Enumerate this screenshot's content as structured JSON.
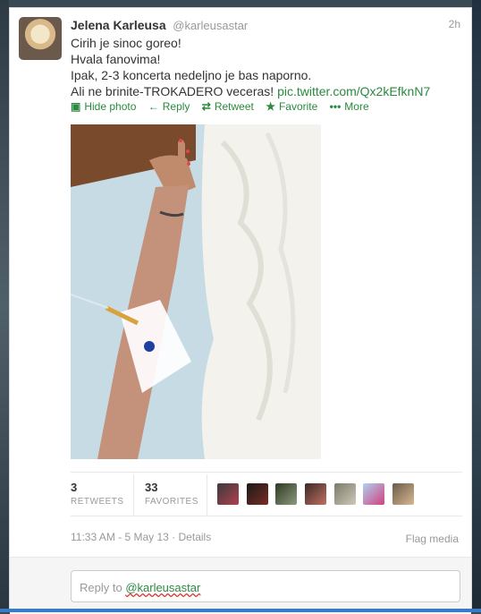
{
  "tweet": {
    "fullname": "Jelena Karleusa",
    "username": "@karleusastar",
    "time": "2h",
    "lines": [
      "Cirih je sinoc goreo!",
      "Hvala fanovima!",
      "Ipak, 2-3 koncerta nedeljno je bas naporno.",
      "Ali ne brinite-TROKADERO veceras! "
    ],
    "link": "pic.twitter.com/Qx2kEfknN7"
  },
  "actions": {
    "hide_photo": "Hide photo",
    "reply": "Reply",
    "retweet": "Retweet",
    "favorite": "Favorite",
    "more": "More"
  },
  "stats": {
    "retweets_count": "3",
    "retweets_label": "RETWEETS",
    "favorites_count": "33",
    "favorites_label": "FAVORITES"
  },
  "meta": {
    "timestamp": "11:33 AM - 5 May 13",
    "separator": " · ",
    "details": "Details",
    "flag_media": "Flag media"
  },
  "reply": {
    "prefix": "Reply to ",
    "mention": "@karleusastar"
  },
  "colors": {
    "link_green": "#2a8a3e",
    "muted": "#999999"
  },
  "icons": [
    "photo-icon",
    "reply-arrow-icon",
    "retweet-icon",
    "star-icon",
    "more-dots-icon"
  ]
}
